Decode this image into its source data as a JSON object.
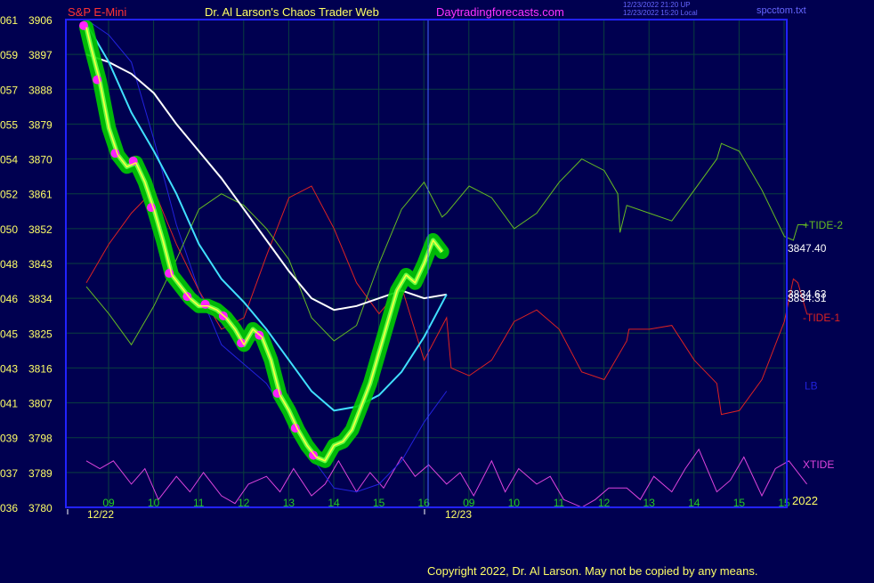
{
  "header": {
    "symbol": "S&P E-Mini",
    "title": "Dr. Al Larson's Chaos Trader Web",
    "site": "Daytradingforecasts.com",
    "timestamp1": "12/23/2022 21:20 UP",
    "timestamp2": "12/23/2022 15:20 Local",
    "file": "spcctom.txt"
  },
  "footer": {
    "copyright": "Copyright 2022, Dr. Al Larson. May not be copied by any means."
  },
  "colors": {
    "background": "#000050",
    "grid": "#0a3f3f",
    "border": "#2222ff",
    "price_glow": "#00cc00",
    "price": "#ffff40",
    "markers": "#ff22ff",
    "ma_fast": "#40e0ff",
    "ma_slow": "#ffffff",
    "tide_plus": "#66bb22",
    "tide_minus": "#dd2222",
    "lb": "#2222dd",
    "xtide": "#dd44dd"
  },
  "chart_data": {
    "type": "line",
    "title": "S&P E-Mini",
    "ylim": [
      3780,
      3906
    ],
    "left_axis": [
      {
        "code": "061",
        "price": "3906"
      },
      {
        "code": "059",
        "price": "3897"
      },
      {
        "code": "057",
        "price": "3888"
      },
      {
        "code": "055",
        "price": "3879"
      },
      {
        "code": "054",
        "price": "3870"
      },
      {
        "code": "052",
        "price": "3861"
      },
      {
        "code": "050",
        "price": "3852"
      },
      {
        "code": "048",
        "price": "3843"
      },
      {
        "code": "046",
        "price": "3834"
      },
      {
        "code": "045",
        "price": "3825"
      },
      {
        "code": "043",
        "price": "3816"
      },
      {
        "code": "041",
        "price": "3807"
      },
      {
        "code": "039",
        "price": "3798"
      },
      {
        "code": "037",
        "price": "3789"
      },
      {
        "code": "036",
        "price": "3780"
      }
    ],
    "x_hours": [
      "09",
      "10",
      "11",
      "12",
      "13",
      "14",
      "15",
      "16",
      "09",
      "10",
      "11",
      "12",
      "13",
      "14",
      "15",
      "15"
    ],
    "x_dates": [
      "12/22",
      "12/23"
    ],
    "year_label": "2022",
    "right_labels": [
      {
        "text": "+TIDE-2",
        "color": "#66bb22",
        "price": 3852.9
      },
      {
        "text": "3847.40",
        "color": "#ffffff",
        "price": 3846.9
      },
      {
        "text": "3834.63",
        "color": "#ffffff",
        "price": 3835.1
      },
      {
        "text": "3834.31",
        "color": "#ffffff",
        "price": 3834.0
      },
      {
        "text": "-TIDE-1",
        "color": "#dd2222",
        "price": 3829.0
      },
      {
        "text": "LB",
        "color": "#2222dd",
        "price": 3811.4
      },
      {
        "text": "XTIDE",
        "color": "#dd44dd",
        "price": 3791.0
      }
    ],
    "series": [
      {
        "name": "price",
        "color": "#ffff40",
        "x": [
          0,
          0.1,
          0.3,
          0.5,
          0.7,
          0.9,
          1.1,
          1.3,
          1.5,
          1.7,
          1.9,
          2.1,
          2.3,
          2.5,
          2.7,
          2.9,
          3.1,
          3.3,
          3.5,
          3.7,
          3.9,
          4.1,
          4.3,
          4.5,
          4.7,
          4.9,
          5.1,
          5.3,
          5.5,
          5.7,
          5.9,
          6.1,
          6.3,
          6.5,
          6.7,
          6.9,
          7.1,
          7.3,
          7.5,
          7.7,
          7.9
        ],
        "y": [
          3904,
          3899,
          3890,
          3878,
          3871,
          3868,
          3869,
          3864,
          3857,
          3849,
          3840,
          3837,
          3834,
          3832,
          3832,
          3831,
          3829,
          3826,
          3822,
          3826,
          3824,
          3818,
          3809,
          3805,
          3800,
          3796,
          3793,
          3792,
          3796,
          3797,
          3800,
          3806,
          3812,
          3820,
          3828,
          3836,
          3840,
          3838,
          3843,
          3849,
          3846
        ]
      },
      {
        "name": "ma-fast",
        "color": "#40e0ff",
        "x": [
          0,
          0.5,
          1,
          1.5,
          2,
          2.5,
          3,
          3.5,
          4,
          4.5,
          5,
          5.5,
          6,
          6.5,
          7,
          7.5,
          8
        ],
        "y": [
          3905,
          3895,
          3882,
          3872,
          3861,
          3848,
          3839,
          3833,
          3826,
          3818,
          3810,
          3805,
          3806,
          3809,
          3815,
          3824,
          3835
        ]
      },
      {
        "name": "ma-slow",
        "color": "#ffffff",
        "x": [
          0,
          0.5,
          1,
          1.5,
          2,
          2.5,
          3,
          3.5,
          4,
          4.5,
          5,
          5.5,
          6,
          6.5,
          7,
          7.5,
          8
        ],
        "y": [
          3897,
          3895,
          3892,
          3887,
          3879,
          3872,
          3865,
          3857,
          3849,
          3841,
          3834,
          3831,
          3832,
          3834,
          3836,
          3834,
          3835
        ]
      },
      {
        "name": "+TIDE-2",
        "color": "#66bb22",
        "x": [
          0,
          0.5,
          1,
          1.5,
          2,
          2.5,
          3,
          3.5,
          4,
          4.5,
          5,
          5.5,
          6,
          6.5,
          7,
          7.5,
          7.9,
          8,
          8.5,
          9,
          9.5,
          10,
          10.5,
          11,
          11.5,
          11.8,
          11.85,
          12,
          12.5,
          13,
          13.5,
          14,
          14.1,
          14.5,
          15,
          15.5,
          15.7,
          15.8,
          16
        ],
        "y": [
          3837,
          3830,
          3822,
          3832,
          3844,
          3857,
          3861,
          3858,
          3852,
          3844,
          3829,
          3823,
          3827,
          3843,
          3857,
          3864,
          3855,
          3856,
          3863,
          3860,
          3852,
          3856,
          3864,
          3870,
          3867,
          3861,
          3851,
          3858,
          3856,
          3854,
          3862,
          3870,
          3874,
          3872,
          3862,
          3850,
          3849,
          3853,
          3853
        ]
      },
      {
        "name": "-TIDE-1",
        "color": "#dd2222",
        "x": [
          0,
          0.5,
          1,
          1.5,
          2,
          2.5,
          3,
          3.5,
          4,
          4.5,
          5,
          5.5,
          6,
          6.5,
          7,
          7.5,
          8,
          8.1,
          8.5,
          9,
          9.5,
          10,
          10.5,
          11,
          11.5,
          12,
          12.05,
          12.5,
          13,
          13.5,
          14,
          14.1,
          14.5,
          15,
          15.5,
          15.7,
          15.8,
          16
        ],
        "y": [
          3838,
          3848,
          3856,
          3862,
          3848,
          3836,
          3826,
          3829,
          3845,
          3860,
          3863,
          3852,
          3838,
          3830,
          3837,
          3818,
          3829,
          3816,
          3814,
          3818,
          3828,
          3831,
          3826,
          3815,
          3813,
          3823,
          3826,
          3826,
          3827,
          3818,
          3812,
          3804,
          3805,
          3813,
          3828,
          3839,
          3838,
          3830
        ]
      },
      {
        "name": "LB",
        "color": "#2222dd",
        "x": [
          0,
          0.5,
          1,
          1.5,
          2,
          2.5,
          3,
          3.5,
          4,
          4.5,
          5,
          5.5,
          6,
          6.5,
          7,
          7.5,
          8
        ],
        "y": [
          3906,
          3902,
          3895,
          3875,
          3853,
          3836,
          3822,
          3817,
          3812,
          3803,
          3793,
          3785,
          3784,
          3786,
          3792,
          3802,
          3810
        ]
      },
      {
        "name": "XTIDE",
        "color": "#dd44dd",
        "x": [
          0,
          0.3,
          0.6,
          1,
          1.3,
          1.6,
          2,
          2.3,
          2.6,
          3,
          3.3,
          3.6,
          4,
          4.3,
          4.6,
          5,
          5.3,
          5.6,
          6,
          6.3,
          6.6,
          7,
          7.3,
          7.6,
          8,
          8.3,
          8.6,
          9,
          9.3,
          9.6,
          10,
          10.3,
          10.6,
          11,
          11.3,
          11.6,
          12,
          12.3,
          12.6,
          13,
          13.3,
          13.6,
          14,
          14.3,
          14.6,
          15,
          15.3,
          15.6,
          16
        ],
        "y": [
          3792,
          3790,
          3792,
          3786,
          3790,
          3782,
          3788,
          3784,
          3789,
          3783,
          3781,
          3786,
          3788,
          3784,
          3790,
          3783,
          3786,
          3792,
          3784,
          3789,
          3785,
          3793,
          3788,
          3791,
          3786,
          3789,
          3783,
          3792,
          3784,
          3790,
          3786,
          3788,
          3782,
          3780,
          3782,
          3785,
          3785,
          3782,
          3788,
          3784,
          3790,
          3795,
          3784,
          3787,
          3793,
          3783,
          3790,
          3792,
          3786
        ]
      }
    ]
  }
}
